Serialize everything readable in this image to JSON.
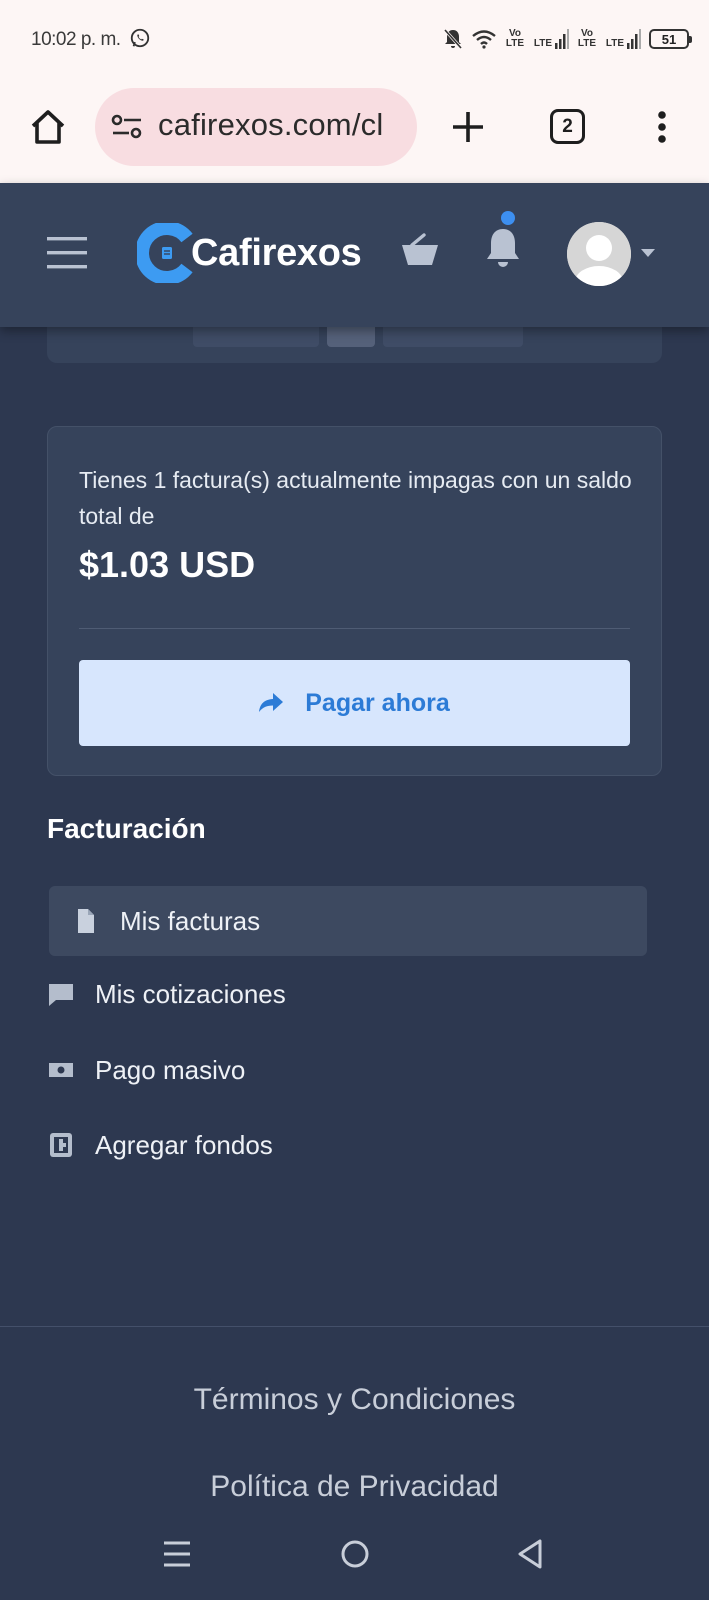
{
  "status_bar": {
    "time": "10:02 p. m.",
    "battery": "51",
    "network_labels": [
      "Vo LTE",
      "LTE",
      "Vo LTE",
      "LTE"
    ],
    "icons": [
      "whatsapp-icon",
      "mute-icon",
      "wifi-icon",
      "signal-icon",
      "battery-icon"
    ]
  },
  "browser": {
    "url": "cafirexos.com/cl",
    "tab_count": "2"
  },
  "header": {
    "brand": "Cafirexos",
    "notification_dot": true
  },
  "unpaid": {
    "message": "Tienes 1 factura(s) actualmente impagas con un saldo total de",
    "amount": "$1.03 USD",
    "pay_button": "Pagar ahora"
  },
  "billing": {
    "title": "Facturación",
    "items": [
      {
        "label": "Mis facturas",
        "icon": "document-icon",
        "active": true
      },
      {
        "label": "Mis cotizaciones",
        "icon": "comment-icon",
        "active": false
      },
      {
        "label": "Pago masivo",
        "icon": "money-icon",
        "active": false
      },
      {
        "label": "Agregar fondos",
        "icon": "funds-icon",
        "active": false
      }
    ]
  },
  "footer": {
    "links": [
      "Términos y Condiciones",
      "Política de Privacidad"
    ]
  },
  "colors": {
    "background": "#2d3850",
    "card": "#36435b",
    "accent": "#2c7bd6",
    "button_bg": "#d7e6fd",
    "logo_blue": "#3d9bf2"
  }
}
